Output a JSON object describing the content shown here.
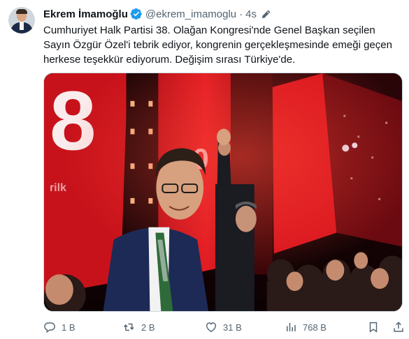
{
  "user": {
    "name": "Ekrem İmamoğlu",
    "handle": "@ekrem_imamoglu",
    "separator": "·",
    "time": "4s"
  },
  "tweet": {
    "lines": [
      "Cumhuriyet Halk Partisi 38. Olağan Kongresi'nde Genel Başkan seçilen",
      "Sayın Özgür Özel'i tebrik ediyor, kongrenin gerçekleşmesinde emeği geçen",
      "herkese teşekkür ediyorum. Değişim sırası Türkiye'de."
    ]
  },
  "actions": {
    "reply_count": "1 B",
    "retweet_count": "2 B",
    "like_count": "31 B",
    "view_count": "768 B"
  },
  "icons": {
    "verified": "verified-badge-icon",
    "edit": "edited-icon",
    "reply": "reply-icon",
    "retweet": "retweet-icon",
    "like": "heart-icon",
    "views": "views-chart-icon",
    "bookmark": "bookmark-icon",
    "share": "share-icon"
  },
  "colors": {
    "verified": "#1d9bf0",
    "text": "#0f1419",
    "muted": "#536471",
    "stage_red": "#d9161e"
  }
}
